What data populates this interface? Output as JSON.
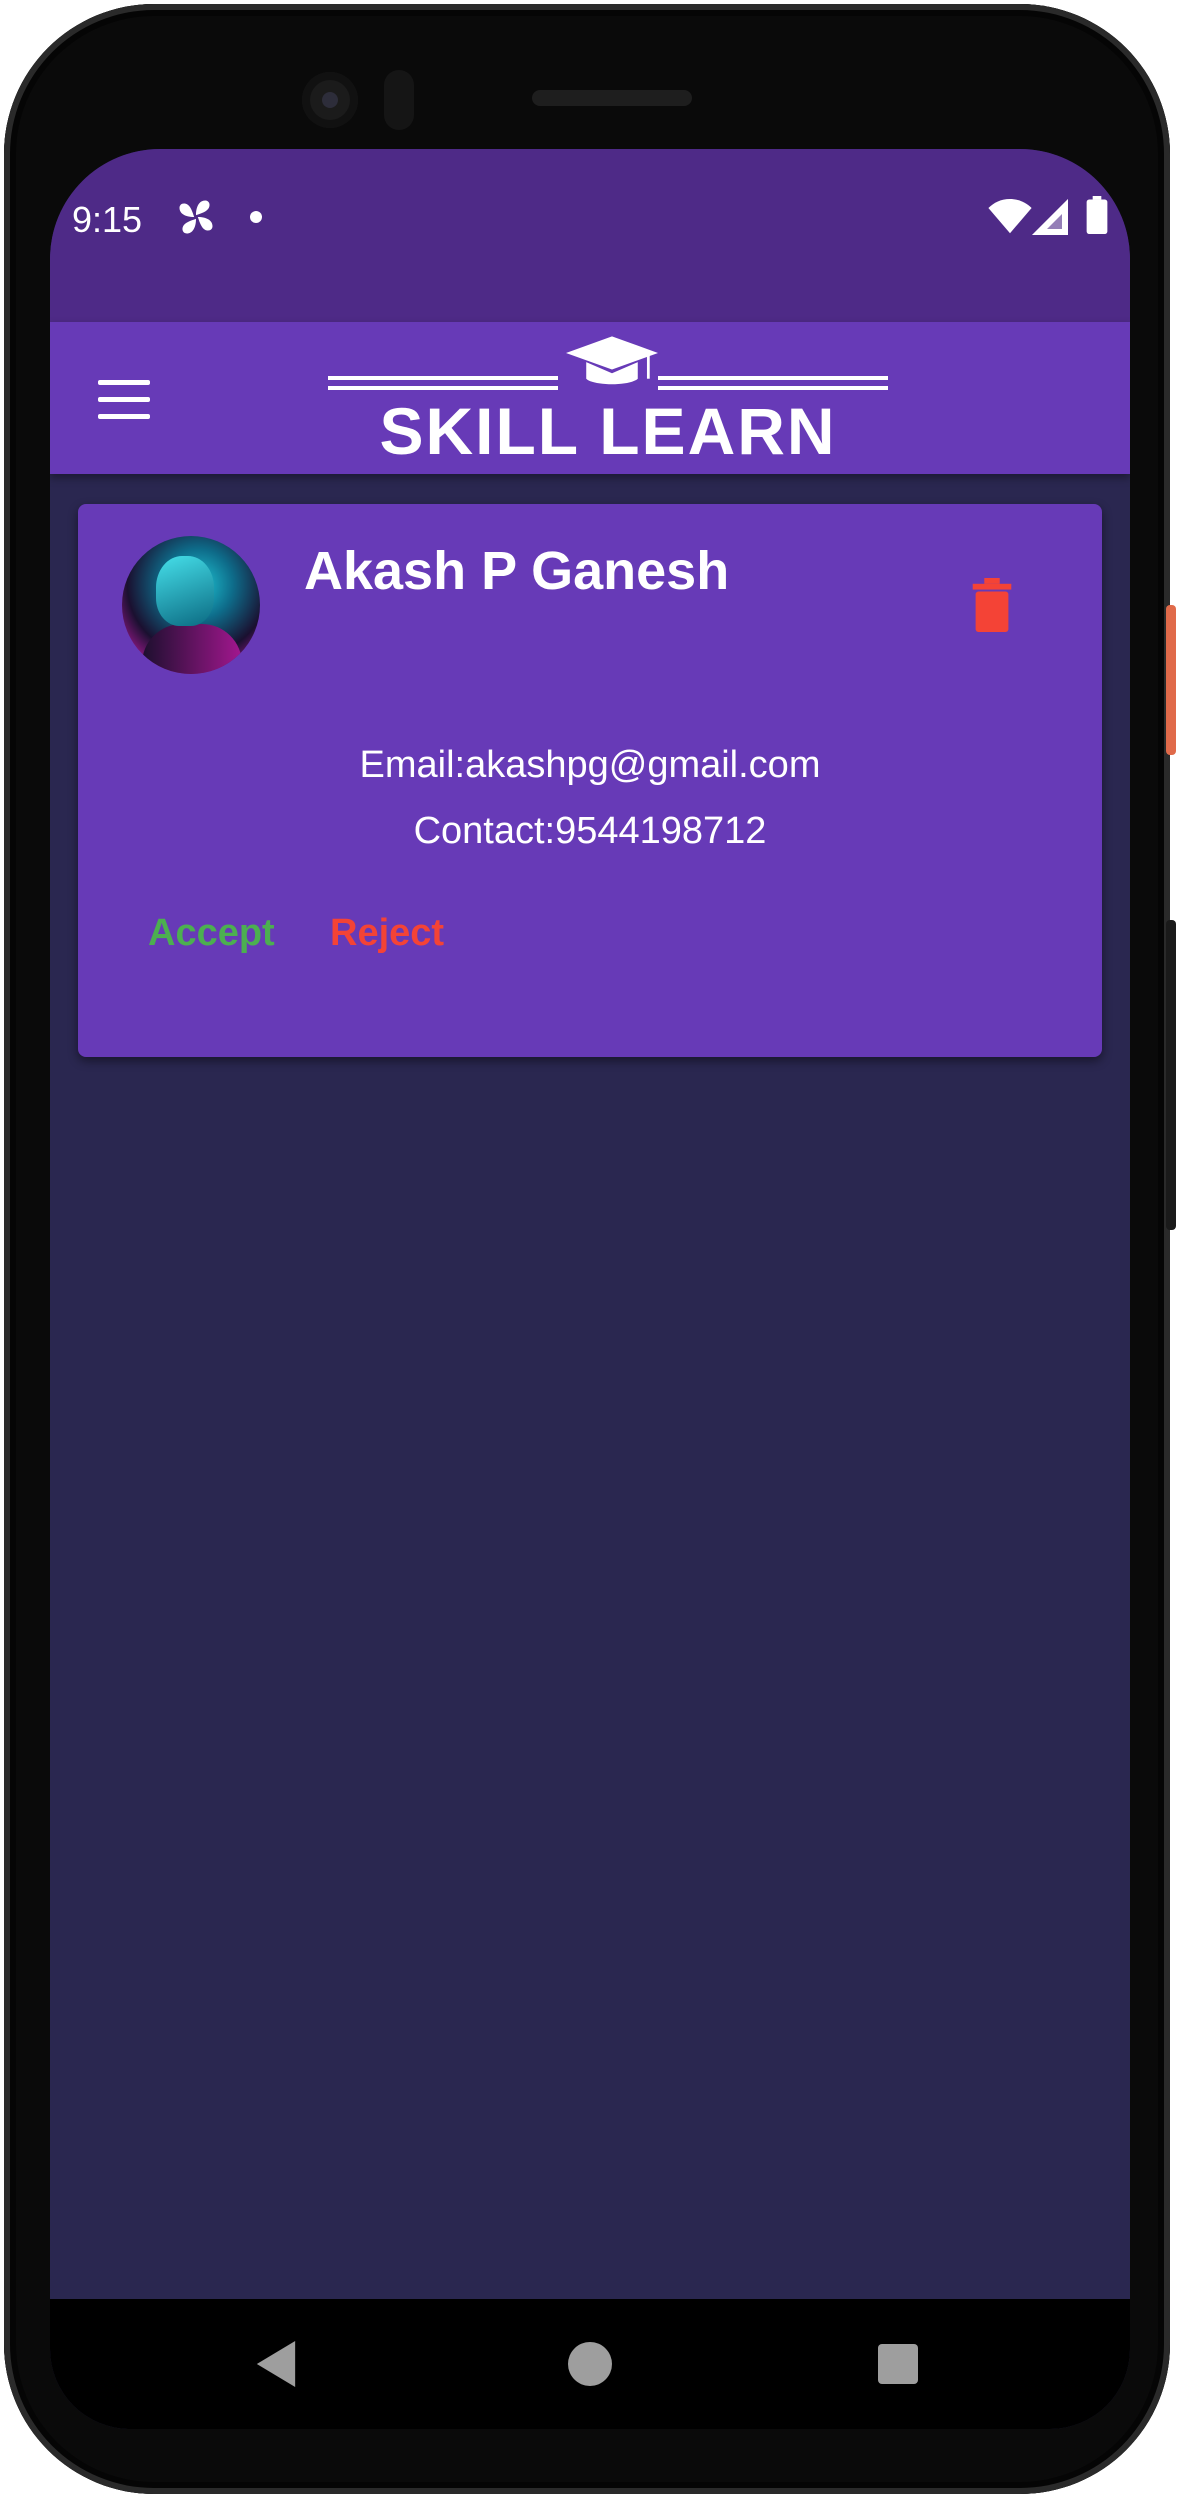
{
  "status_bar": {
    "time": "9:15",
    "icons": [
      "pinwheel-icon",
      "notification-dot-icon",
      "wifi-icon",
      "signal-icon",
      "battery-icon"
    ]
  },
  "app_bar": {
    "logo_text": "SKILL LEARN",
    "logo_icon": "graduation-cap-icon",
    "menu_icon": "hamburger-menu-icon"
  },
  "request_card": {
    "name": "Akash P Ganesh",
    "email": "Email:akashpg@gmail.com",
    "contact": "Contact:9544198712",
    "accept_label": "Accept",
    "reject_label": "Reject",
    "delete_icon": "trash-icon"
  },
  "nav_bar": {
    "icons": [
      "back-icon",
      "home-icon",
      "recents-icon"
    ]
  },
  "colors": {
    "status_bar": "#4e2a87",
    "app_bar": "#673ab7",
    "background": "#2a2750",
    "card": "#673ab7",
    "accept": "#4caf50",
    "reject": "#f44336",
    "delete": "#f44336"
  }
}
